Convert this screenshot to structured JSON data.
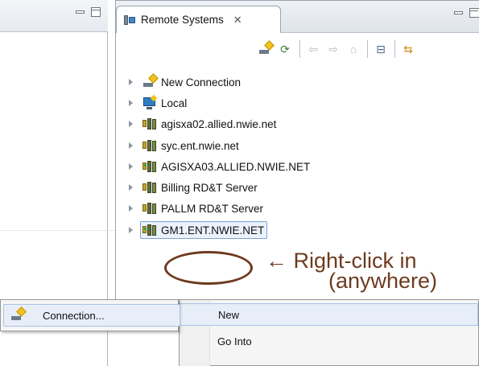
{
  "left_view": {
    "minimize_icon": "minimize-icon",
    "maximize_icon": "maximize-icon"
  },
  "remote_systems": {
    "tab_title": "Remote Systems",
    "tab_close": "✕",
    "toolbar": {
      "icons": [
        "new-connection-icon",
        "refresh-icon",
        "back-icon",
        "forward-icon",
        "home-icon",
        "collapse-all-icon",
        "link-with-editor-icon"
      ]
    },
    "tree": [
      {
        "label": "New Connection",
        "icon": "new-connection-icon",
        "selected": false
      },
      {
        "label": "Local",
        "icon": "local-system-icon",
        "selected": false
      },
      {
        "label": "agisxa02.allied.nwie.net",
        "icon": "server-icon",
        "selected": false
      },
      {
        "label": "syc.ent.nwie.net",
        "icon": "server-icon",
        "selected": false
      },
      {
        "label": "AGISXA03.ALLIED.NWIE.NET",
        "icon": "server-icon",
        "selected": false
      },
      {
        "label": "Billing RD&T Server",
        "icon": "server-icon",
        "selected": false
      },
      {
        "label": "PALLM RD&T Server",
        "icon": "server-icon",
        "selected": false
      },
      {
        "label": "GM1.ENT.NWIE.NET",
        "icon": "server-icon",
        "selected": true
      }
    ]
  },
  "annotation": {
    "line1": "← Right-click in",
    "line2": "(anywhere)",
    "color": "#6e3a1e"
  },
  "context_menu": {
    "items": [
      {
        "label": "New",
        "highlighted": true
      },
      {
        "label": "Go Into",
        "highlighted": false
      }
    ]
  },
  "submenu": {
    "items": [
      {
        "label": "Connection...",
        "icon": "new-connection-icon"
      }
    ]
  }
}
